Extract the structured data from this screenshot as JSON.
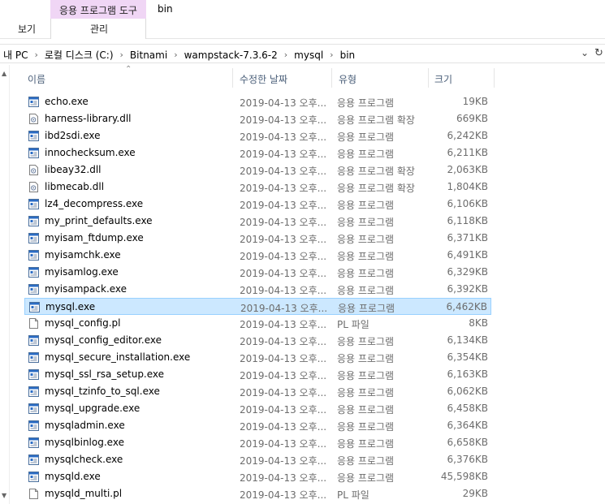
{
  "ribbon": {
    "context_group": "응용 프로그램 도구",
    "folder_name": "bin",
    "tab_view": "보기",
    "tab_manage": "관리"
  },
  "address": {
    "crumbs": [
      "내 PC",
      "로컬 디스크 (C:)",
      "Bitnami",
      "wampstack-7.3.6-2",
      "mysql",
      "bin"
    ]
  },
  "columns": {
    "name": "이름",
    "date": "수정한 날짜",
    "type": "유형",
    "size": "크기"
  },
  "files": [
    {
      "name": "echo.exe",
      "date": "2019-04-13 오후...",
      "type": "응용 프로그램",
      "size": "19KB",
      "icon": "exe"
    },
    {
      "name": "harness-library.dll",
      "date": "2019-04-13 오후...",
      "type": "응용 프로그램 확장",
      "size": "669KB",
      "icon": "dll"
    },
    {
      "name": "ibd2sdi.exe",
      "date": "2019-04-13 오후...",
      "type": "응용 프로그램",
      "size": "6,242KB",
      "icon": "exe"
    },
    {
      "name": "innochecksum.exe",
      "date": "2019-04-13 오후...",
      "type": "응용 프로그램",
      "size": "6,211KB",
      "icon": "exe"
    },
    {
      "name": "libeay32.dll",
      "date": "2019-04-13 오후...",
      "type": "응용 프로그램 확장",
      "size": "2,063KB",
      "icon": "dll"
    },
    {
      "name": "libmecab.dll",
      "date": "2019-04-13 오후...",
      "type": "응용 프로그램 확장",
      "size": "1,804KB",
      "icon": "dll"
    },
    {
      "name": "lz4_decompress.exe",
      "date": "2019-04-13 오후...",
      "type": "응용 프로그램",
      "size": "6,106KB",
      "icon": "exe"
    },
    {
      "name": "my_print_defaults.exe",
      "date": "2019-04-13 오후...",
      "type": "응용 프로그램",
      "size": "6,118KB",
      "icon": "exe"
    },
    {
      "name": "myisam_ftdump.exe",
      "date": "2019-04-13 오후...",
      "type": "응용 프로그램",
      "size": "6,371KB",
      "icon": "exe"
    },
    {
      "name": "myisamchk.exe",
      "date": "2019-04-13 오후...",
      "type": "응용 프로그램",
      "size": "6,491KB",
      "icon": "exe"
    },
    {
      "name": "myisamlog.exe",
      "date": "2019-04-13 오후...",
      "type": "응용 프로그램",
      "size": "6,329KB",
      "icon": "exe"
    },
    {
      "name": "myisampack.exe",
      "date": "2019-04-13 오후...",
      "type": "응용 프로그램",
      "size": "6,392KB",
      "icon": "exe"
    },
    {
      "name": "mysql.exe",
      "date": "2019-04-13 오후...",
      "type": "응용 프로그램",
      "size": "6,462KB",
      "icon": "exe",
      "selected": true
    },
    {
      "name": "mysql_config.pl",
      "date": "2019-04-13 오후...",
      "type": "PL 파일",
      "size": "8KB",
      "icon": "file"
    },
    {
      "name": "mysql_config_editor.exe",
      "date": "2019-04-13 오후...",
      "type": "응용 프로그램",
      "size": "6,134KB",
      "icon": "exe"
    },
    {
      "name": "mysql_secure_installation.exe",
      "date": "2019-04-13 오후...",
      "type": "응용 프로그램",
      "size": "6,354KB",
      "icon": "exe"
    },
    {
      "name": "mysql_ssl_rsa_setup.exe",
      "date": "2019-04-13 오후...",
      "type": "응용 프로그램",
      "size": "6,163KB",
      "icon": "exe"
    },
    {
      "name": "mysql_tzinfo_to_sql.exe",
      "date": "2019-04-13 오후...",
      "type": "응용 프로그램",
      "size": "6,062KB",
      "icon": "exe"
    },
    {
      "name": "mysql_upgrade.exe",
      "date": "2019-04-13 오후...",
      "type": "응용 프로그램",
      "size": "6,458KB",
      "icon": "exe"
    },
    {
      "name": "mysqladmin.exe",
      "date": "2019-04-13 오후...",
      "type": "응용 프로그램",
      "size": "6,364KB",
      "icon": "exe"
    },
    {
      "name": "mysqlbinlog.exe",
      "date": "2019-04-13 오후...",
      "type": "응용 프로그램",
      "size": "6,658KB",
      "icon": "exe"
    },
    {
      "name": "mysqlcheck.exe",
      "date": "2019-04-13 오후...",
      "type": "응용 프로그램",
      "size": "6,376KB",
      "icon": "exe"
    },
    {
      "name": "mysqld.exe",
      "date": "2019-04-13 오후...",
      "type": "응용 프로그램",
      "size": "45,598KB",
      "icon": "exe"
    },
    {
      "name": "mysqld_multi.pl",
      "date": "2019-04-13 오후...",
      "type": "PL 파일",
      "size": "29KB",
      "icon": "file"
    }
  ],
  "colors": {
    "context_band": "#f0d6f5",
    "selected_row": "#cce8ff",
    "selected_border": "#99d1ff",
    "header_text": "#4c607a",
    "exe_icon_blue": "#2b6cc4"
  }
}
